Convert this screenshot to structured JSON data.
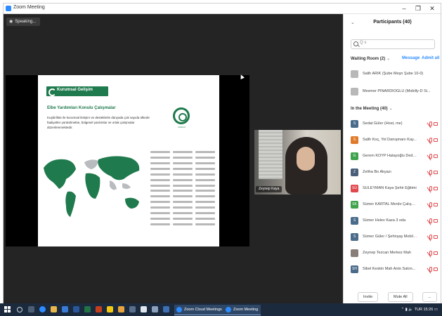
{
  "window": {
    "title": "Zoom Meeting"
  },
  "meeting": {
    "speaker_chip": "Speaking...",
    "video_name": "Zeynep Kaya",
    "slide": {
      "heading": "Kurumsal Gelişim",
      "subheading": "Elbe Yardımları Konulu Çalışmalar",
      "paragraph": "Kuşbirlikte ile kurumsal iletişim ve desteklerle dünyada çok sayıda ülkede faaliyetler yürütülmekte, bölgesel yardımlar ve ortak çalışmalar düzenlenmektedir.",
      "logo_caption": "KIZILAY",
      "map_color": "#1f7a4d"
    }
  },
  "participants": {
    "title": "Participants (40)",
    "search_placeholder": "Q s",
    "waiting": {
      "header": "Waiting Room (2)",
      "message_label": "Message",
      "admit_label": "Admit all",
      "rows": [
        {
          "name": "Salih ARİK (Şube Meşn Şube 10-0)",
          "initial": "",
          "color": "#b8b8b8"
        },
        {
          "name": "Mesmer PINARDİOĞLU (Mobilly-D Si...",
          "initial": "",
          "color": "#b8b8b8"
        }
      ]
    },
    "in_meeting": {
      "header": "In the Meeting (40)",
      "rows": [
        {
          "name": "Sedat Güler (Host, me)",
          "initial": "S",
          "color": "#4a6b8a"
        },
        {
          "name": "Salih Koç, Yol Danışmanı Kay...",
          "initial": "S",
          "color": "#e07b2b"
        },
        {
          "name": "Gerem KOYP Hatayoğlu Dedo...",
          "initial": "G",
          "color": "#3fa34d"
        },
        {
          "name": "Zeliha Bo Akyazı",
          "initial": "Z",
          "color": "#4a5f7a"
        },
        {
          "name": "SÜLEYMAN Kaya Şehir Eğitimi",
          "initial": "SÜ",
          "color": "#e0484d"
        },
        {
          "name": "Sümer KARTAL Merdo Çalışma...",
          "initial": "SK",
          "color": "#3fa34d"
        },
        {
          "name": "Sümer Helev Kaza 3 oda",
          "initial": "S",
          "color": "#4a6b8a"
        },
        {
          "name": "Sümer Güler / Şehirşaş Mobilya...",
          "initial": "S",
          "color": "#4a6b8a"
        },
        {
          "name": "Zeynep Tezcan Merkez Mah",
          "initial": "",
          "color": "#8a7f78"
        },
        {
          "name": "Sibel Keskin Mah Anto Salon...",
          "initial": "SH",
          "color": "#4a6b8a"
        }
      ]
    },
    "footer": {
      "invite": "Invite",
      "mute_all": "Mute All",
      "more": "..."
    }
  },
  "taskbar": {
    "apps": [
      "Zoom Cloud Meetings",
      "Zoom Meeting"
    ],
    "tray_time": "15:26",
    "tray_lang": "TUR"
  }
}
